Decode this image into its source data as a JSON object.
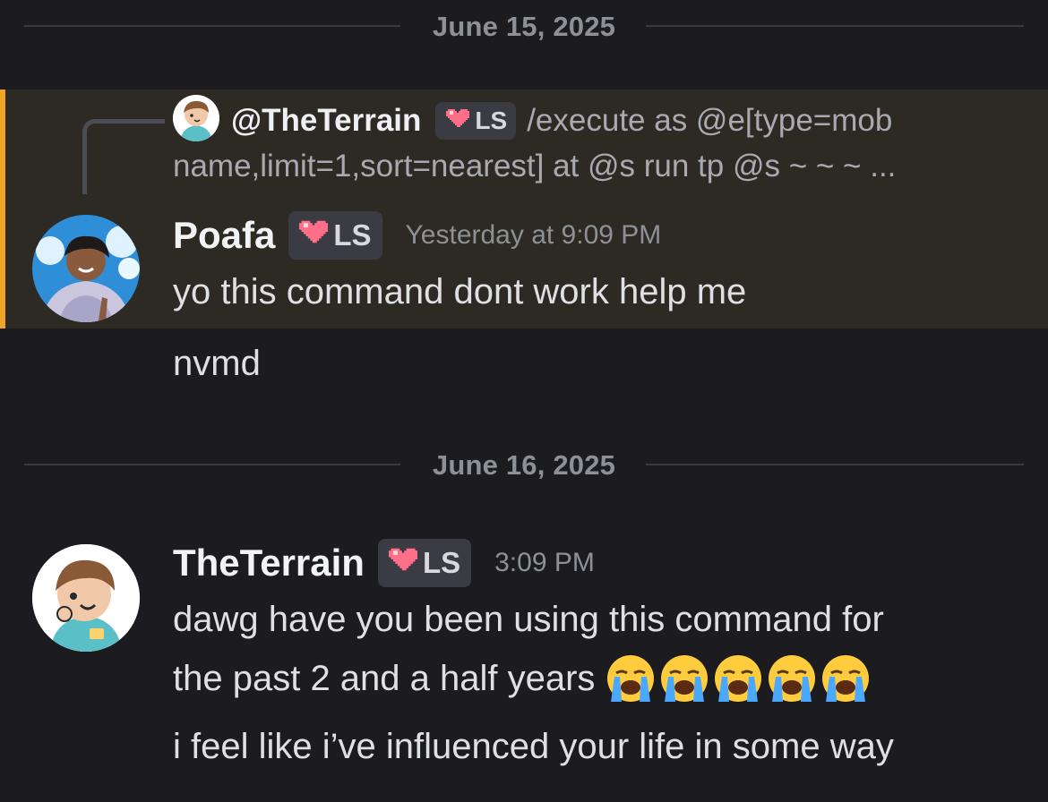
{
  "dividers": [
    {
      "label": "June 15, 2025"
    },
    {
      "label": "June 16, 2025"
    }
  ],
  "colors": {
    "background": "#1b1b20",
    "highlight": "#2d2a24",
    "mention_bar": "#f0a52a",
    "tag_bg": "#3b3b43"
  },
  "reply": {
    "author": "@TheTerrain",
    "tag": "LS",
    "text_line1": "/execute as @e[type=mob",
    "text_line2": "name,limit=1,sort=nearest] at @s run tp @s ~ ~ ~ ..."
  },
  "message1": {
    "author": "Poafa",
    "tag": "LS",
    "timestamp": "Yesterday at 9:09 PM",
    "text": "yo this command dont work help me"
  },
  "message1_followup": {
    "text": "nvmd"
  },
  "message2": {
    "author": "TheTerrain",
    "tag": "LS",
    "timestamp": "3:09 PM",
    "line1": "dawg have you been using this command for",
    "line2": "the past 2 and a half years",
    "emojis": [
      "loudly-crying-face",
      "loudly-crying-face",
      "loudly-crying-face",
      "loudly-crying-face",
      "loudly-crying-face"
    ]
  },
  "message2_followup": {
    "text": "i feel like i’ve influenced your life in some way"
  }
}
